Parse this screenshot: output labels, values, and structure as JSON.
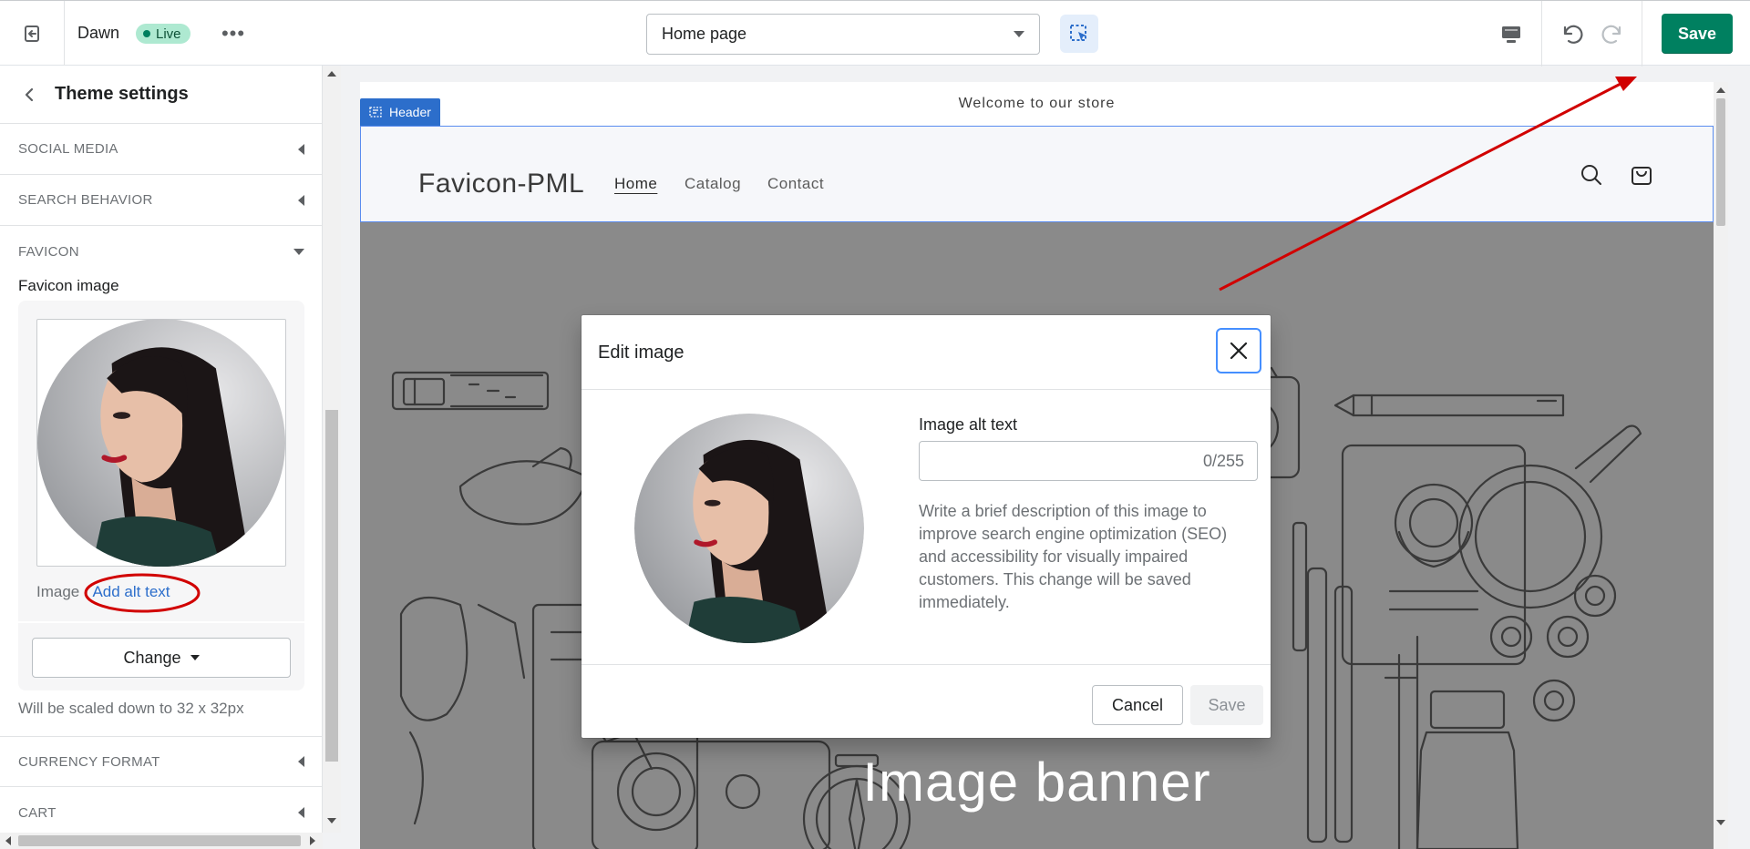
{
  "topbar": {
    "theme_name": "Dawn",
    "live_badge": "Live",
    "more_label": "•••",
    "page_select": "Home page",
    "save_label": "Save"
  },
  "sidebar": {
    "title": "Theme settings",
    "sections": {
      "social_media": "SOCIAL MEDIA",
      "search_behavior": "SEARCH BEHAVIOR",
      "favicon": "FAVICON",
      "currency_format": "CURRENCY FORMAT",
      "cart": "CART"
    },
    "favicon": {
      "label": "Favicon image",
      "image_prefix": "Image",
      "image_separator": "·",
      "add_alt_text": "Add alt text",
      "change_label": "Change",
      "help_text": "Will be scaled down to 32 x 32px"
    }
  },
  "preview": {
    "announcement": "Welcome to our store",
    "header_tag": "Header",
    "store_name": "Favicon-PML",
    "nav": [
      "Home",
      "Catalog",
      "Contact"
    ],
    "banner_title": "Image banner"
  },
  "modal": {
    "title": "Edit image",
    "alt_label": "Image alt text",
    "alt_value": "",
    "alt_counter": "0/255",
    "help": "Write a brief description of this image to improve search engine optimization (SEO) and accessibility for visually impaired customers. This change will be saved immediately.",
    "cancel_label": "Cancel",
    "save_label": "Save"
  },
  "colors": {
    "primary_green": "#008060",
    "accent_blue": "#2c6ecb",
    "annotation_red": "#d10000"
  },
  "icons": [
    "exit-icon",
    "more-icon",
    "inspector-icon",
    "desktop-icon",
    "undo-icon",
    "redo-icon",
    "back-chevron-icon",
    "search-icon",
    "cart-icon",
    "close-icon",
    "section-icon"
  ]
}
